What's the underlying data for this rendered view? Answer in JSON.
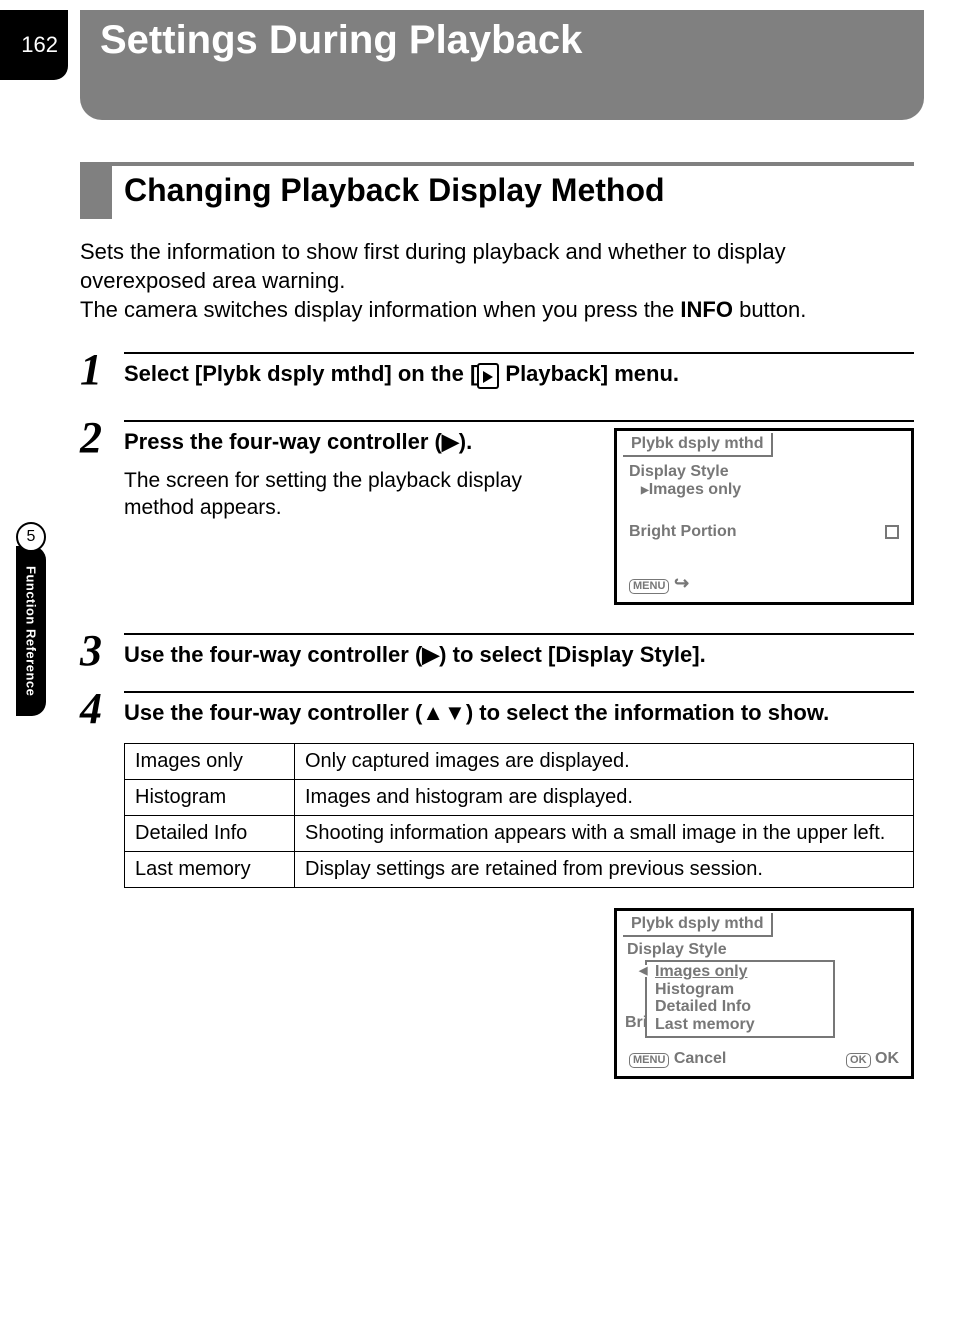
{
  "page_number": "162",
  "chapter_title": "Settings During Playback",
  "side_tab": {
    "number": "5",
    "label": "Function Reference"
  },
  "section_title": "Changing Playback Display Method",
  "intro": {
    "line1": "Sets the information to show first during playback and whether to display overexposed area warning.",
    "line2_pre": "The camera switches display information when you press the ",
    "info_label": "INFO",
    "line2_post": " button."
  },
  "steps": {
    "s1": {
      "num": "1",
      "heading_pre": "Select [Plybk dsply mthd] on the [",
      "heading_post": " Playback] menu."
    },
    "s2": {
      "num": "2",
      "heading": "Press the four-way controller (▶).",
      "sub": "The screen for setting the playback display method appears."
    },
    "s3": {
      "num": "3",
      "heading": "Use the four-way controller (▶) to select [Display Style]."
    },
    "s4": {
      "num": "4",
      "heading": "Use the four-way controller (▲▼) to select the information to show."
    }
  },
  "lcd1": {
    "tab": "Plybk dsply mthd",
    "row1": "Display Style",
    "row1_value": "Images only",
    "row2": "Bright Portion",
    "footer_menu": "MENU"
  },
  "options_table": {
    "rows": [
      {
        "label": "Images only",
        "desc": "Only captured images are displayed."
      },
      {
        "label": "Histogram",
        "desc": "Images and histogram are displayed."
      },
      {
        "label": "Detailed Info",
        "desc": "Shooting information appears with a small image in the upper left."
      },
      {
        "label": "Last memory",
        "desc": "Display settings are retained from previous session."
      }
    ]
  },
  "lcd2": {
    "tab": "Plybk dsply mthd",
    "row1": "Display Style",
    "dropdown": [
      "Images only",
      "Histogram",
      "Detailed Info",
      "Last memory"
    ],
    "behind": "Bri",
    "footer_menu": "MENU",
    "footer_cancel": "Cancel",
    "footer_ok_badge": "OK",
    "footer_ok": "OK"
  }
}
